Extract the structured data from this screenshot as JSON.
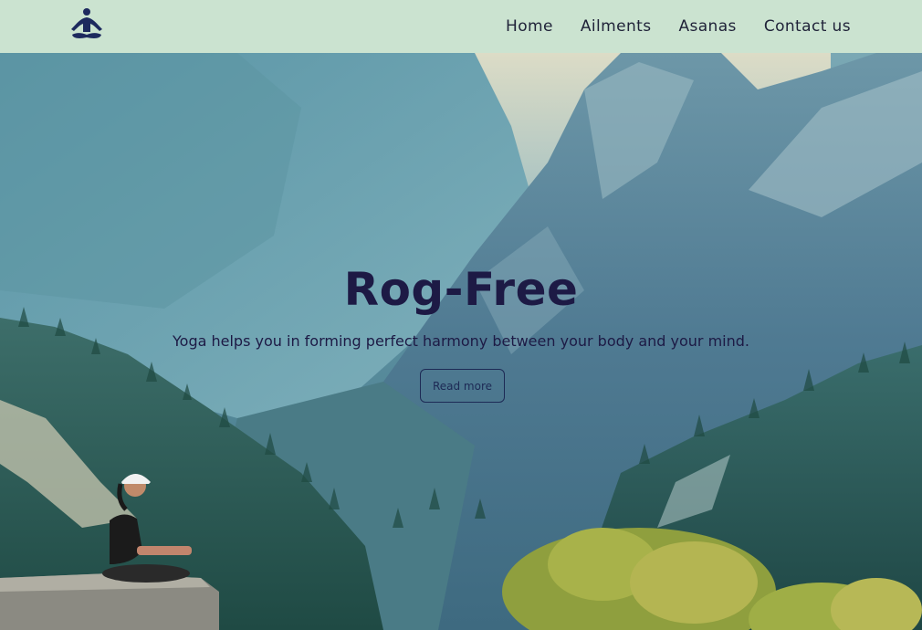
{
  "nav": {
    "logo_icon": "meditation-pose-icon",
    "links": [
      "Home",
      "Ailments",
      "Asanas",
      "Contact us"
    ]
  },
  "hero": {
    "title": "Rog-Free",
    "tagline": "Yoga helps you in forming perfect harmony between your body and your mind.",
    "cta": "Read more"
  },
  "colors": {
    "nav_bg": "#cbe3d0",
    "text_dark": "#1d1a45"
  }
}
